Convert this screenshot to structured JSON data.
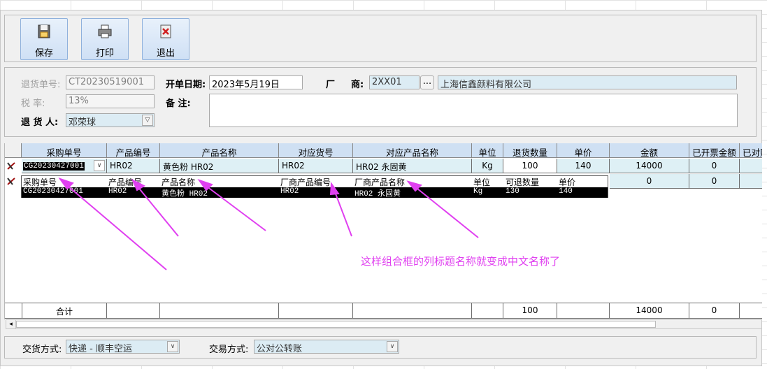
{
  "toolbar": {
    "save_label": "保存",
    "print_label": "打印",
    "exit_label": "退出"
  },
  "header": {
    "return_no_label": "退货单号:",
    "return_no_value": "CT20230519001",
    "date_label": "开单日期:",
    "date_value": "2023年5月19日",
    "vendor_label_1": "厂",
    "vendor_label_2": "商:",
    "vendor_code": "2XX01",
    "vendor_browse": "...",
    "vendor_name": "上海信鑫颜料有限公司",
    "tax_label": "税    率:",
    "tax_value": "13%",
    "remark_label": "备    注:",
    "remark_value": "",
    "returner_label": "退 货 人:",
    "returner_value": "邓荣球"
  },
  "grid": {
    "columns": [
      "采购单号",
      "产品编号",
      "产品名称",
      "对应货号",
      "对应产品名称",
      "单位",
      "退货数量",
      "单价",
      "金额",
      "已开票金额",
      "已对账"
    ],
    "rows": [
      [
        "CG20230427001",
        "HR02",
        "黄色粉 HR02",
        "HR02",
        "HR02 永固黄",
        "Kg",
        "100",
        "140",
        "14000",
        "0",
        ""
      ],
      [
        "",
        "",
        "",
        "",
        "",
        "",
        "",
        "",
        "0",
        "0",
        ""
      ]
    ],
    "total_label": "合计",
    "totals": {
      "qty": "100",
      "amount": "14000",
      "invoiced": "0"
    }
  },
  "dropdown": {
    "headers": [
      "采购单号",
      "产品编号",
      "产品名称",
      "厂商产品编号",
      "厂商产品名称",
      "单位",
      "可退数量",
      "单价"
    ],
    "row": [
      "CG20230427001",
      "HR02",
      "黄色粉 HR02",
      "HR02",
      "HR02 永固黄",
      "Kg",
      "130",
      "140"
    ]
  },
  "annotation": "这样组合框的列标题名称就变成中文名称了",
  "footer": {
    "delivery_label": "交货方式:",
    "delivery_value": "快递 - 顺丰空运",
    "trade_label": "交易方式:",
    "trade_value": "公对公转账"
  },
  "colors": {
    "annotation": "#e040f0",
    "header_bg": "#cfe0f3",
    "row_bg": "#def0f5"
  }
}
